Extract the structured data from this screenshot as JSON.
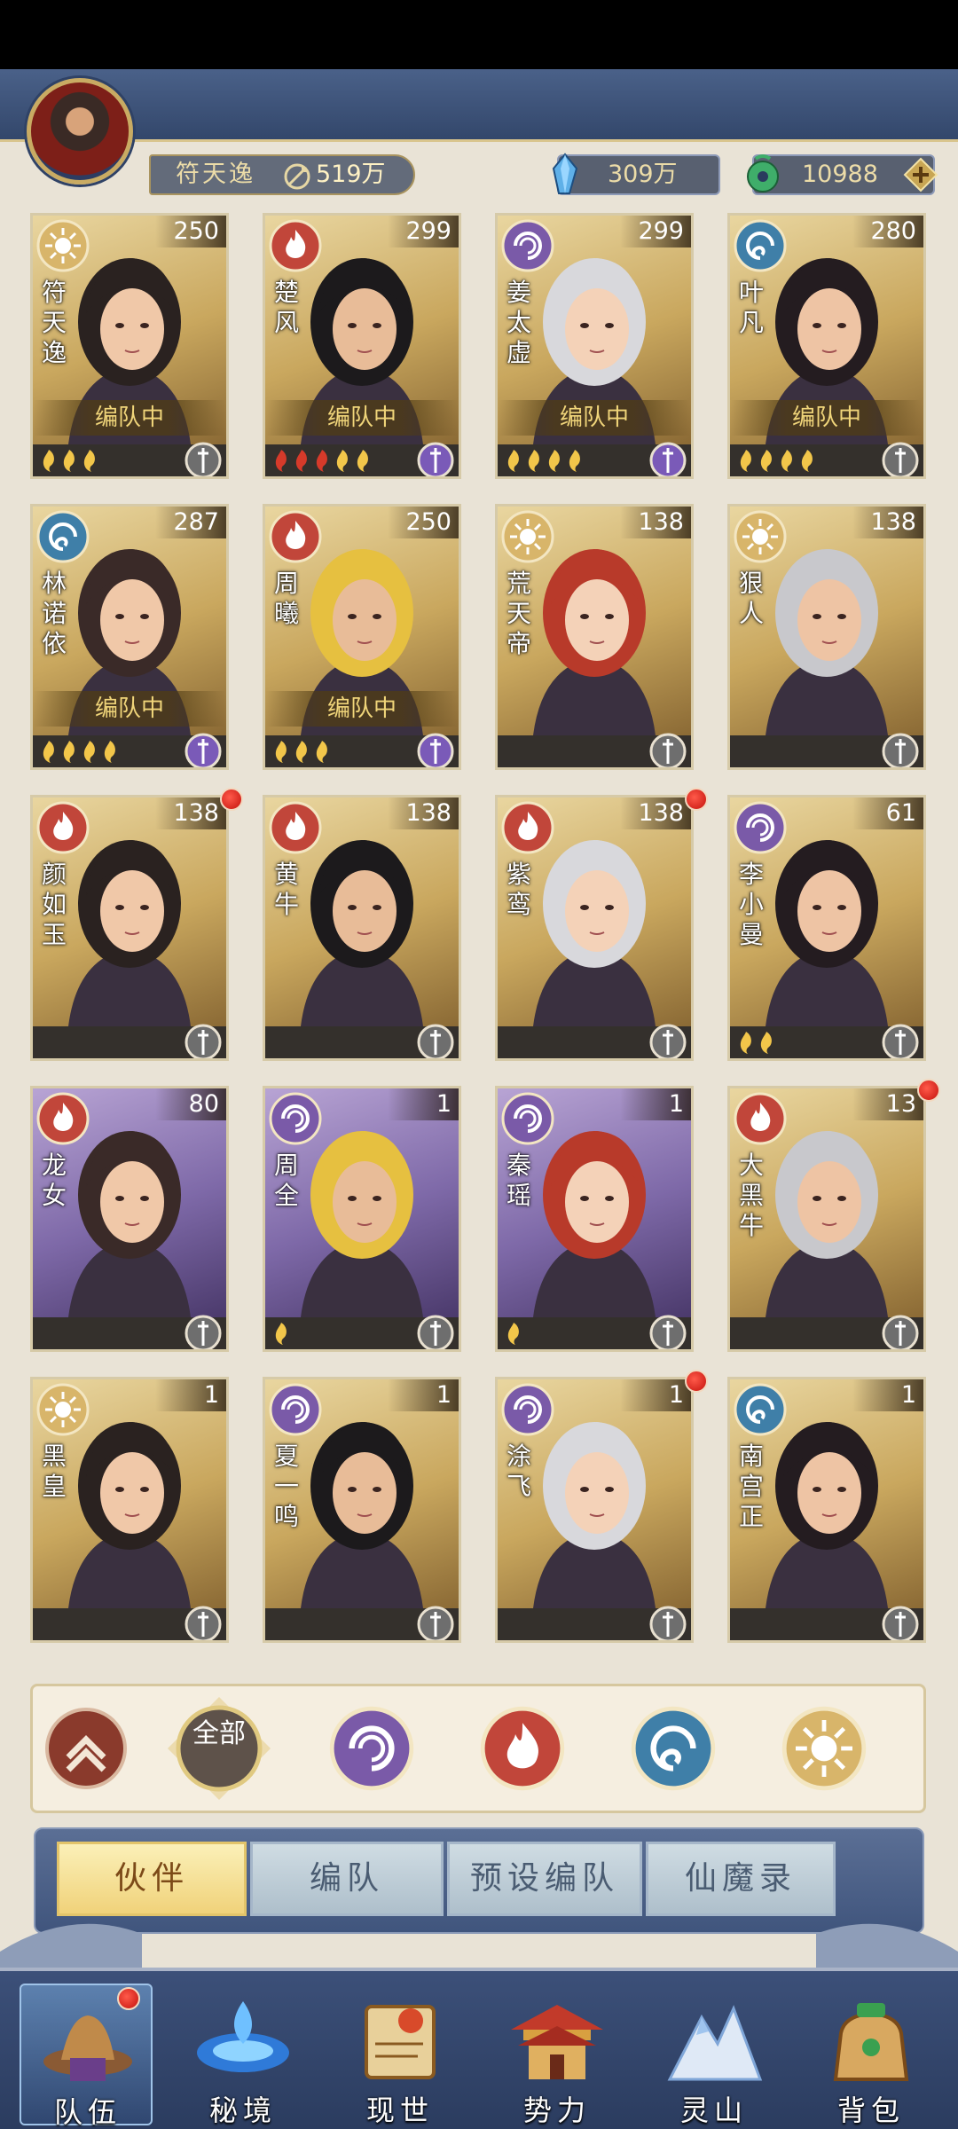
{
  "player": {
    "name": "符天逸",
    "power": "519万"
  },
  "currency": {
    "crystal": "309万",
    "jade": "10988"
  },
  "colors": {
    "fire": "#c1463a",
    "arcane": "#7a5aa8",
    "water": "#3f7fa8",
    "light": "#d8b56a",
    "inteam": "#f0d57a"
  },
  "characters": [
    {
      "name": "符天逸",
      "count": "250",
      "element": "light",
      "frame": "gold",
      "in_team": "编队中",
      "stars": 3,
      "red_stars": 0,
      "badge": "silver"
    },
    {
      "name": "楚风",
      "count": "299",
      "element": "fire",
      "frame": "gold",
      "in_team": "编队中",
      "stars": 5,
      "red_stars": 3,
      "badge": "purple"
    },
    {
      "name": "姜太虚",
      "count": "299",
      "element": "arcane",
      "frame": "gold",
      "in_team": "编队中",
      "stars": 4,
      "red_stars": 0,
      "badge": "purple"
    },
    {
      "name": "叶凡",
      "count": "280",
      "element": "water",
      "frame": "gold",
      "in_team": "编队中",
      "stars": 4,
      "red_stars": 0,
      "badge": "silver"
    },
    {
      "name": "林诺依",
      "count": "287",
      "element": "water",
      "frame": "gold",
      "in_team": "编队中",
      "stars": 4,
      "red_stars": 0,
      "badge": "purple"
    },
    {
      "name": "周曦",
      "count": "250",
      "element": "fire",
      "frame": "gold",
      "in_team": "编队中",
      "stars": 3,
      "red_stars": 0,
      "badge": "purple"
    },
    {
      "name": "荒天帝",
      "count": "138",
      "element": "light",
      "frame": "gold",
      "in_team": "",
      "stars": 0,
      "red_stars": 0,
      "badge": "silver"
    },
    {
      "name": "狠人",
      "count": "138",
      "element": "light",
      "frame": "gold",
      "in_team": "",
      "stars": 0,
      "red_stars": 0,
      "badge": "silver"
    },
    {
      "name": "颜如玉",
      "count": "138",
      "element": "fire",
      "frame": "gold",
      "in_team": "",
      "stars": 0,
      "red_stars": 0,
      "badge": "silver",
      "alert": true
    },
    {
      "name": "黄牛",
      "count": "138",
      "element": "fire",
      "frame": "gold",
      "in_team": "",
      "stars": 0,
      "red_stars": 0,
      "badge": "silver"
    },
    {
      "name": "紫鸾",
      "count": "138",
      "element": "fire",
      "frame": "gold",
      "in_team": "",
      "stars": 0,
      "red_stars": 0,
      "badge": "silver",
      "alert": true
    },
    {
      "name": "李小曼",
      "count": "61",
      "element": "arcane",
      "frame": "gold",
      "in_team": "",
      "stars": 2,
      "red_stars": 0,
      "badge": "silver"
    },
    {
      "name": "龙女",
      "count": "80",
      "element": "fire",
      "frame": "purple",
      "in_team": "",
      "stars": 0,
      "red_stars": 0,
      "badge": "silver"
    },
    {
      "name": "周全",
      "count": "1",
      "element": "arcane",
      "frame": "purple",
      "in_team": "",
      "stars": 1,
      "red_stars": 0,
      "badge": "silver"
    },
    {
      "name": "秦瑶",
      "count": "1",
      "element": "arcane",
      "frame": "purple",
      "in_team": "",
      "stars": 1,
      "red_stars": 0,
      "badge": "silver"
    },
    {
      "name": "大黑牛",
      "count": "13",
      "element": "fire",
      "frame": "gold",
      "in_team": "",
      "stars": 0,
      "red_stars": 0,
      "badge": "silver",
      "alert": true
    },
    {
      "name": "黑皇",
      "count": "1",
      "element": "light",
      "frame": "gold",
      "in_team": "",
      "stars": 0,
      "red_stars": 0,
      "badge": "silver"
    },
    {
      "name": "夏一鸣",
      "count": "1",
      "element": "arcane",
      "frame": "gold",
      "in_team": "",
      "stars": 0,
      "red_stars": 0,
      "badge": "silver"
    },
    {
      "name": "涂飞",
      "count": "1",
      "element": "arcane",
      "frame": "gold",
      "in_team": "",
      "stars": 0,
      "red_stars": 0,
      "badge": "silver",
      "alert": true
    },
    {
      "name": "南宫正",
      "count": "1",
      "element": "water",
      "frame": "gold",
      "in_team": "",
      "stars": 0,
      "red_stars": 0,
      "badge": "silver"
    }
  ],
  "filters": [
    {
      "id": "rank",
      "icon": "chevron-up-icon"
    },
    {
      "id": "all",
      "label": "全部",
      "icon": "all-icon",
      "selected": true
    },
    {
      "id": "arcane",
      "icon": "arcane-icon"
    },
    {
      "id": "fire",
      "icon": "fire-icon"
    },
    {
      "id": "water",
      "icon": "water-icon"
    },
    {
      "id": "light",
      "icon": "light-icon"
    }
  ],
  "tabs": [
    {
      "label": "伙伴",
      "active": true
    },
    {
      "label": "编队",
      "active": false
    },
    {
      "label": "预设编队",
      "active": false
    },
    {
      "label": "仙魔录",
      "active": false
    }
  ],
  "nav": [
    {
      "label": "队伍",
      "icon": "team-hat-icon",
      "active": true,
      "alert": true
    },
    {
      "label": "秘境",
      "icon": "portal-icon",
      "active": false
    },
    {
      "label": "现世",
      "icon": "scroll-icon",
      "active": false
    },
    {
      "label": "势力",
      "icon": "palace-icon",
      "active": false
    },
    {
      "label": "灵山",
      "icon": "mountain-icon",
      "active": false
    },
    {
      "label": "背包",
      "icon": "bag-icon",
      "active": false
    }
  ]
}
